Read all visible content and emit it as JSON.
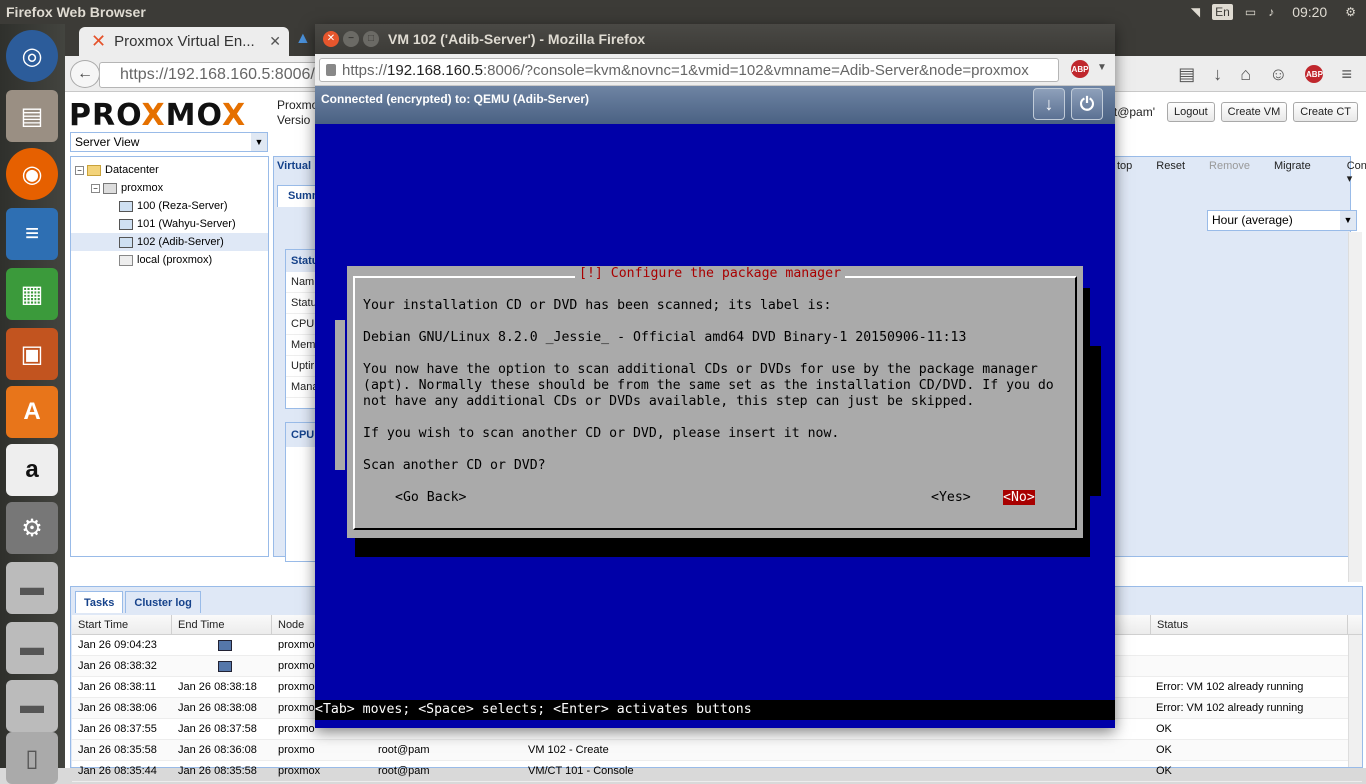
{
  "system": {
    "app_title": "Firefox Web Browser",
    "keyboard_layout": "En",
    "clock": "09:20"
  },
  "launcher": {
    "items": [
      "ubuntu-dash-icon",
      "files-icon",
      "firefox-icon",
      "writer-icon",
      "calc-icon",
      "impress-icon",
      "software-center-icon",
      "amazon-icon",
      "system-settings-icon",
      "drive-icon",
      "drive-icon",
      "drive-icon",
      "trash-icon"
    ]
  },
  "main_browser": {
    "tab_title": "Proxmox Virtual En...",
    "url": "https://192.168.160.5:8006/"
  },
  "proxmox": {
    "logo_pro": "PRO",
    "logo_x": "X",
    "logo_mo": "MO",
    "logo_x2": "X",
    "version_line1": "Proxmo",
    "version_line2": "Versio",
    "user": "ot@pam'",
    "buttons": {
      "logout": "Logout",
      "create_vm": "Create VM",
      "create_ct": "Create CT"
    },
    "server_view": "Server View",
    "panel_title": "Virtual",
    "tab_summary": "Summ",
    "toolbar": {
      "stop": "top",
      "reset": "Reset",
      "remove": "Remove",
      "migrate": "Migrate",
      "console": "Console"
    },
    "timeframe": "Hour (average)",
    "status_panel": {
      "header": "Statu",
      "rows": [
        "Nam",
        "Statu",
        "CPU",
        "Mem",
        "Uptir",
        "Mana"
      ]
    },
    "cpu_panel_header": "CPU",
    "tree": {
      "datacenter": "Datacenter",
      "node": "proxmox",
      "vms": [
        "100 (Reza-Server)",
        "101 (Wahyu-Server)",
        "102 (Adib-Server)"
      ],
      "storage": "local (proxmox)"
    },
    "bottom_tabs": {
      "tasks": "Tasks",
      "cluster_log": "Cluster log"
    },
    "task_columns": {
      "start": "Start Time",
      "end": "End Time",
      "node": "Node",
      "status": "Status"
    },
    "tasks": [
      {
        "start": "Jan 26 09:04:23",
        "end": "",
        "node": "proxmo",
        "user": "",
        "desc": "",
        "status": ""
      },
      {
        "start": "Jan 26 08:38:32",
        "end": "",
        "node": "proxmo",
        "user": "",
        "desc": "",
        "status": ""
      },
      {
        "start": "Jan 26 08:38:11",
        "end": "Jan 26 08:38:18",
        "node": "proxmo",
        "user": "",
        "desc": "",
        "status": "Error: VM 102 already running"
      },
      {
        "start": "Jan 26 08:38:06",
        "end": "Jan 26 08:38:08",
        "node": "proxmo",
        "user": "",
        "desc": "",
        "status": "Error: VM 102 already running"
      },
      {
        "start": "Jan 26 08:37:55",
        "end": "Jan 26 08:37:58",
        "node": "proxmo",
        "user": "",
        "desc": "",
        "status": "OK"
      },
      {
        "start": "Jan 26 08:35:58",
        "end": "Jan 26 08:36:08",
        "node": "proxmo",
        "user": "root@pam",
        "desc": "VM 102 - Create",
        "status": "OK"
      },
      {
        "start": "Jan 26 08:35:44",
        "end": "Jan 26 08:35:58",
        "node": "proxmox",
        "user": "root@pam",
        "desc": "VM/CT 101 - Console",
        "status": "OK"
      }
    ]
  },
  "console_window": {
    "title": "VM 102 ('Adib-Server') - Mozilla Firefox",
    "url_prefix": "https://",
    "url_host": "192.168.160.5",
    "url_rest": ":8006/?console=kvm&novnc=1&vmid=102&vmname=Adib-Server&node=proxmox",
    "novnc_status": "Connected (encrypted) to: QEMU (Adib-Server)"
  },
  "installer": {
    "dialog_title": "[!] Configure the package manager",
    "line1": "Your installation CD or DVD has been scanned; its label is:",
    "line2": "Debian GNU/Linux 8.2.0 _Jessie_ - Official amd64 DVD Binary-1 20150906-11:13",
    "line3": "You now have the option to scan additional CDs or DVDs for use by the package manager",
    "line4": "(apt). Normally these should be from the same set as the installation CD/DVD. If you do",
    "line5": "not have any additional CDs or DVDs available, this step can just be skipped.",
    "line6": "If you wish to scan another CD or DVD, please insert it now.",
    "line7": "Scan another CD or DVD?",
    "btn_back": "<Go Back>",
    "btn_yes": "<Yes>",
    "btn_no": "<No>",
    "help": "<Tab> moves; <Space> selects; <Enter> activates buttons"
  }
}
